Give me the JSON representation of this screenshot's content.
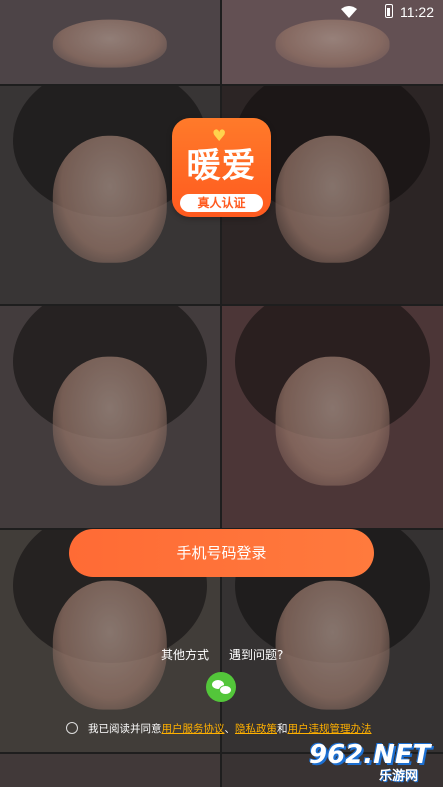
{
  "status_bar": {
    "time": "11:22"
  },
  "logo": {
    "title": "暖爱",
    "badge": "真人认证"
  },
  "login": {
    "phone_button": "手机号码登录"
  },
  "alt": {
    "other_methods": "其他方式",
    "problem": "遇到问题?"
  },
  "agreement": {
    "prefix": "我已阅读并同意",
    "service": "用户服务协议",
    "sep1": "、",
    "privacy": "隐私政策",
    "and": "和",
    "violation": "用户违规管理办法"
  },
  "watermark": {
    "main": "962.NET",
    "sub": "乐游网"
  },
  "colors": {
    "accent": "#ff6b35",
    "link": "#ffb000",
    "wechat": "#53c63a"
  }
}
